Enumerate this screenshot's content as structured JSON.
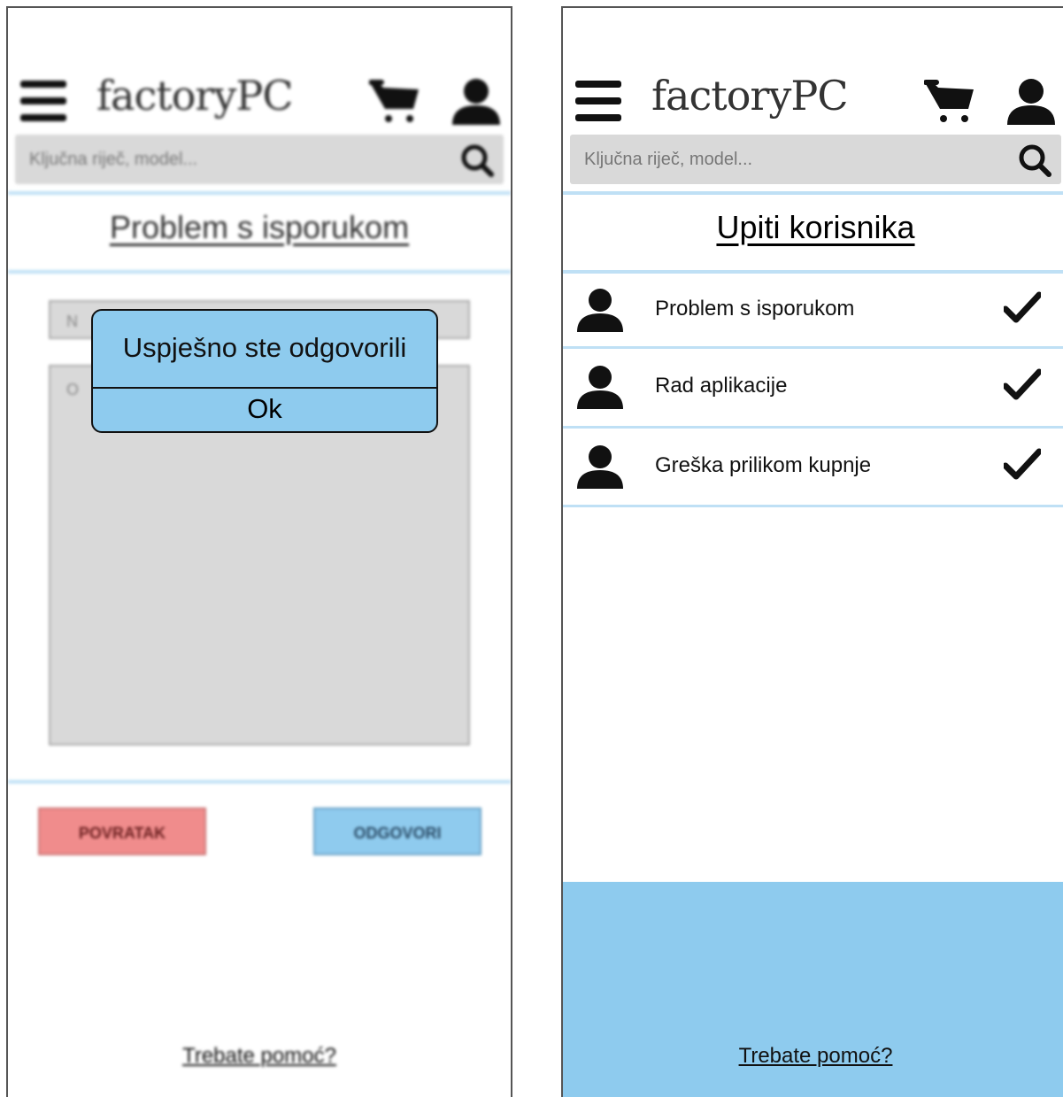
{
  "header": {
    "logo_text": "factoryPC",
    "search_placeholder": "Ključna riječ, model..."
  },
  "left_screen": {
    "title": "Problem s isporukom",
    "name_field_placeholder": "N",
    "answer_placeholder": "O",
    "dialog": {
      "message": "Uspješno ste odgovorili",
      "ok_label": "Ok"
    },
    "back_button": "POVRATAK",
    "reply_button": "ODGOVORI"
  },
  "right_screen": {
    "title": "Upiti korisnika",
    "inquiries": [
      {
        "label": "Problem s isporukom"
      },
      {
        "label": "Rad aplikacije"
      },
      {
        "label": "Greška prilikom kupnje"
      }
    ]
  },
  "footer": {
    "help_link": "Trebate pomoć?"
  },
  "colors": {
    "accent_blue": "#8ecbee",
    "back_red": "#f08c8c",
    "field_gray": "#d9d9d9"
  }
}
